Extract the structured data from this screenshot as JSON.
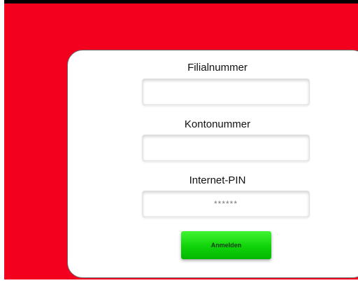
{
  "colors": {
    "background": "#f4001f",
    "card": "#ffffff",
    "button_gradient": [
      "#3ff531",
      "#03b800"
    ],
    "button_text": "#123d12"
  },
  "login": {
    "branch_number": {
      "label": "Filialnummer",
      "value": "",
      "placeholder": ""
    },
    "account_number": {
      "label": "Kontonummer",
      "value": "",
      "placeholder": ""
    },
    "internet_pin": {
      "label": "Internet-PIN",
      "value": "",
      "placeholder": "******"
    },
    "submit_label": "Anmelden"
  }
}
